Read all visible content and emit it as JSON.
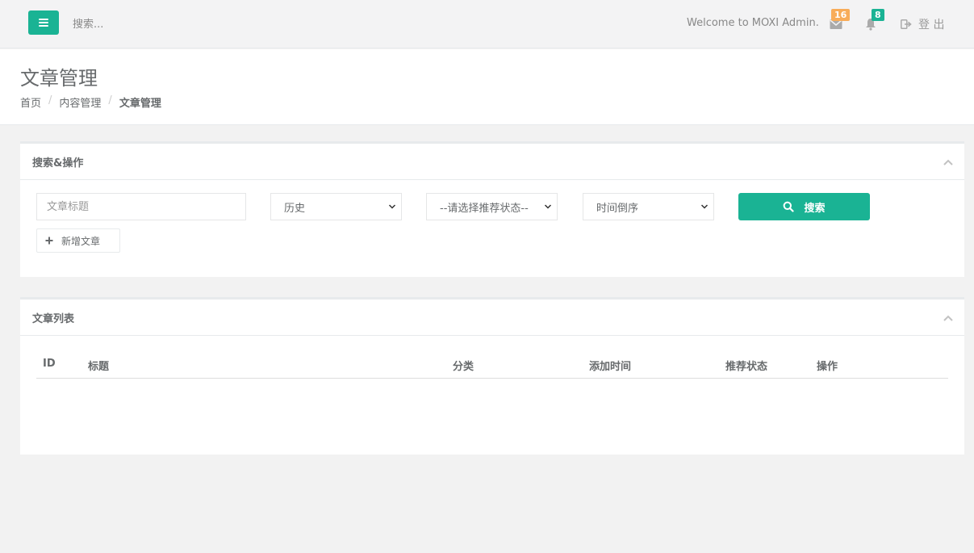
{
  "topbar": {
    "search_placeholder": "搜索...",
    "welcome": "Welcome to MOXI Admin.",
    "messages_count": "16",
    "alerts_count": "8",
    "logout_label": "登 出"
  },
  "heading": {
    "title": "文章管理",
    "breadcrumb": [
      "首页",
      "内容管理",
      "文章管理"
    ]
  },
  "search_panel": {
    "title": "搜索&操作",
    "title_input_placeholder": "文章标题",
    "category_select": "历史",
    "recommend_select": "--请选择推荐状态--",
    "sort_select": "时间倒序",
    "search_button": "搜索",
    "add_button": "新增文章"
  },
  "list_panel": {
    "title": "文章列表",
    "columns": [
      "ID",
      "标题",
      "分类",
      "添加时间",
      "推荐状态",
      "操作"
    ]
  },
  "colors": {
    "primary": "#1ab394",
    "warning": "#f8ac59"
  }
}
